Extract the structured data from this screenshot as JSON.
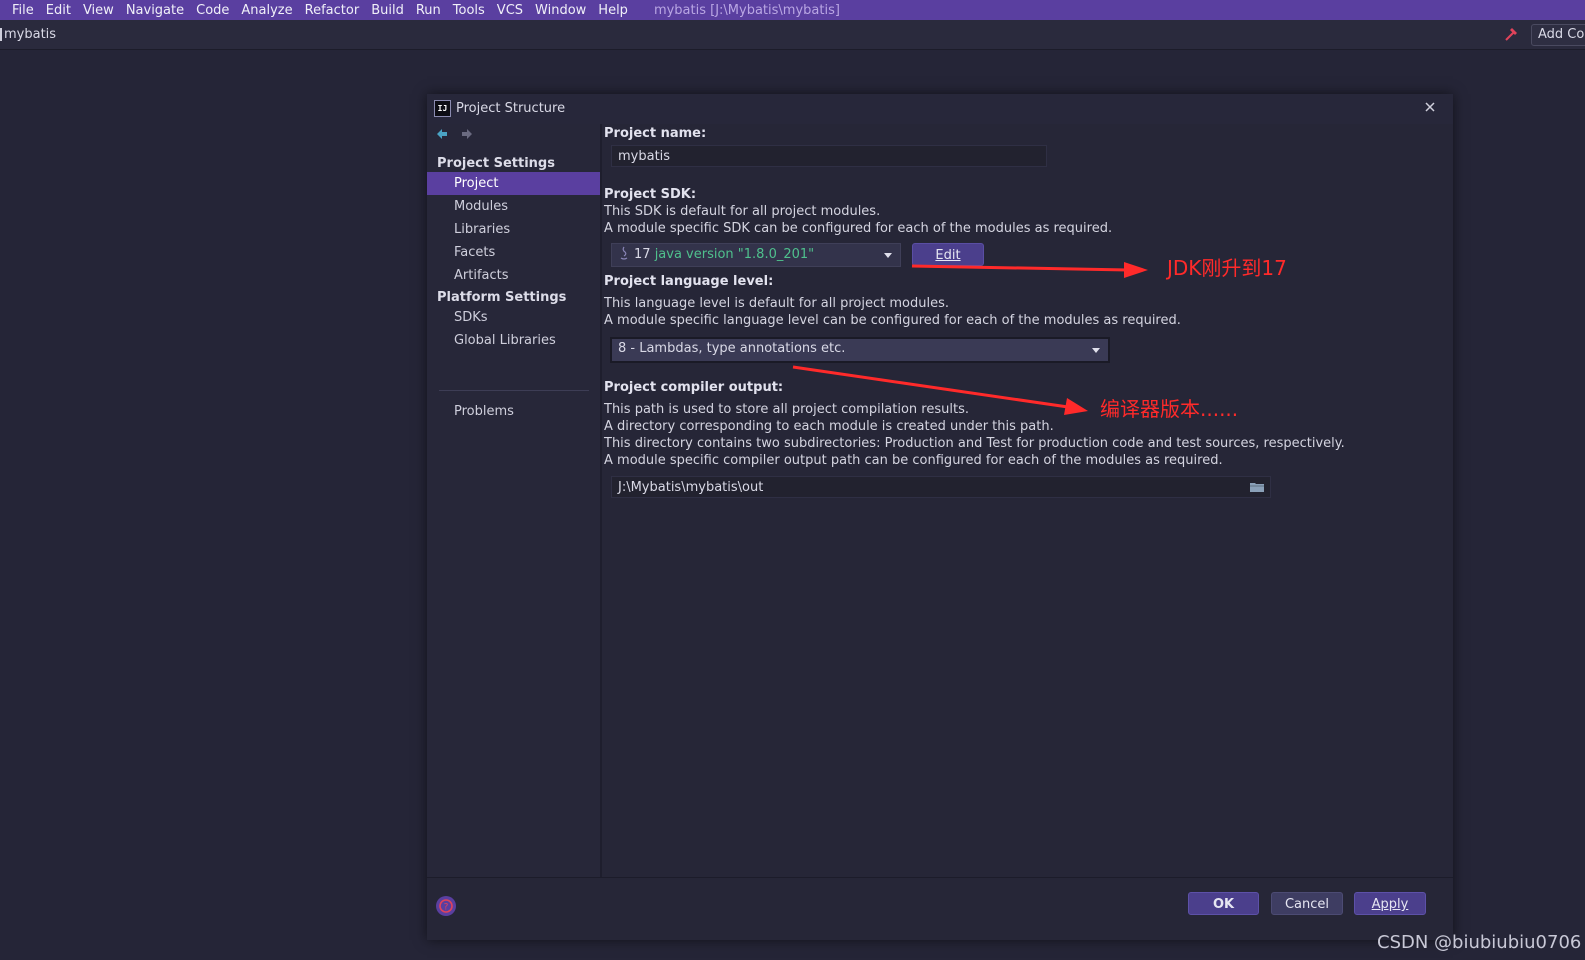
{
  "menubar": {
    "items": [
      "File",
      "Edit",
      "View",
      "Navigate",
      "Code",
      "Analyze",
      "Refactor",
      "Build",
      "Run",
      "Tools",
      "VCS",
      "Window",
      "Help"
    ],
    "window_title": "mybatis [J:\\Mybatis\\mybatis]"
  },
  "navbar": {
    "project": "mybatis",
    "add_configuration": "Add Con"
  },
  "dialog": {
    "title": "Project Structure",
    "sidebar": {
      "project_settings_header": "Project Settings",
      "project_settings_items": [
        "Project",
        "Modules",
        "Libraries",
        "Facets",
        "Artifacts"
      ],
      "platform_settings_header": "Platform Settings",
      "platform_settings_items": [
        "SDKs",
        "Global Libraries"
      ],
      "problems": "Problems",
      "selected": "Project"
    },
    "content": {
      "project_name_label": "Project name:",
      "project_name_value": "mybatis",
      "sdk_label": "Project SDK:",
      "sdk_desc_1": "This SDK is default for all project modules.",
      "sdk_desc_2": "A module specific SDK can be configured for each of the modules as required.",
      "sdk_name": "17",
      "sdk_version": "java version \"1.8.0_201\"",
      "edit_button": "Edit",
      "language_level_label": "Project language level:",
      "language_desc_1": "This language level is default for all project modules.",
      "language_desc_2": "A module specific language level can be configured for each of the modules as required.",
      "language_level_value": "8 - Lambdas, type annotations etc.",
      "compiler_output_label": "Project compiler output:",
      "compiler_desc_1": "This path is used to store all project compilation results.",
      "compiler_desc_2": "A directory corresponding to each module is created under this path.",
      "compiler_desc_3": "This directory contains two subdirectories: Production and Test for production code and test sources, respectively.",
      "compiler_desc_4": "A module specific compiler output path can be configured for each of the modules as required.",
      "compiler_output_path": "J:\\Mybatis\\mybatis\\out"
    },
    "buttons": {
      "ok": "OK",
      "cancel": "Cancel",
      "apply": "Apply"
    }
  },
  "annotations": {
    "jdk_note": "JDK刚升到17",
    "compiler_note": "编译器版本......",
    "color": "#ff2a2a"
  },
  "watermark": "CSDN @biubiubiu0706",
  "colors": {
    "accent": "#5a3fa0",
    "background": "#252537",
    "sdk_version_text": "#4fc08d"
  }
}
